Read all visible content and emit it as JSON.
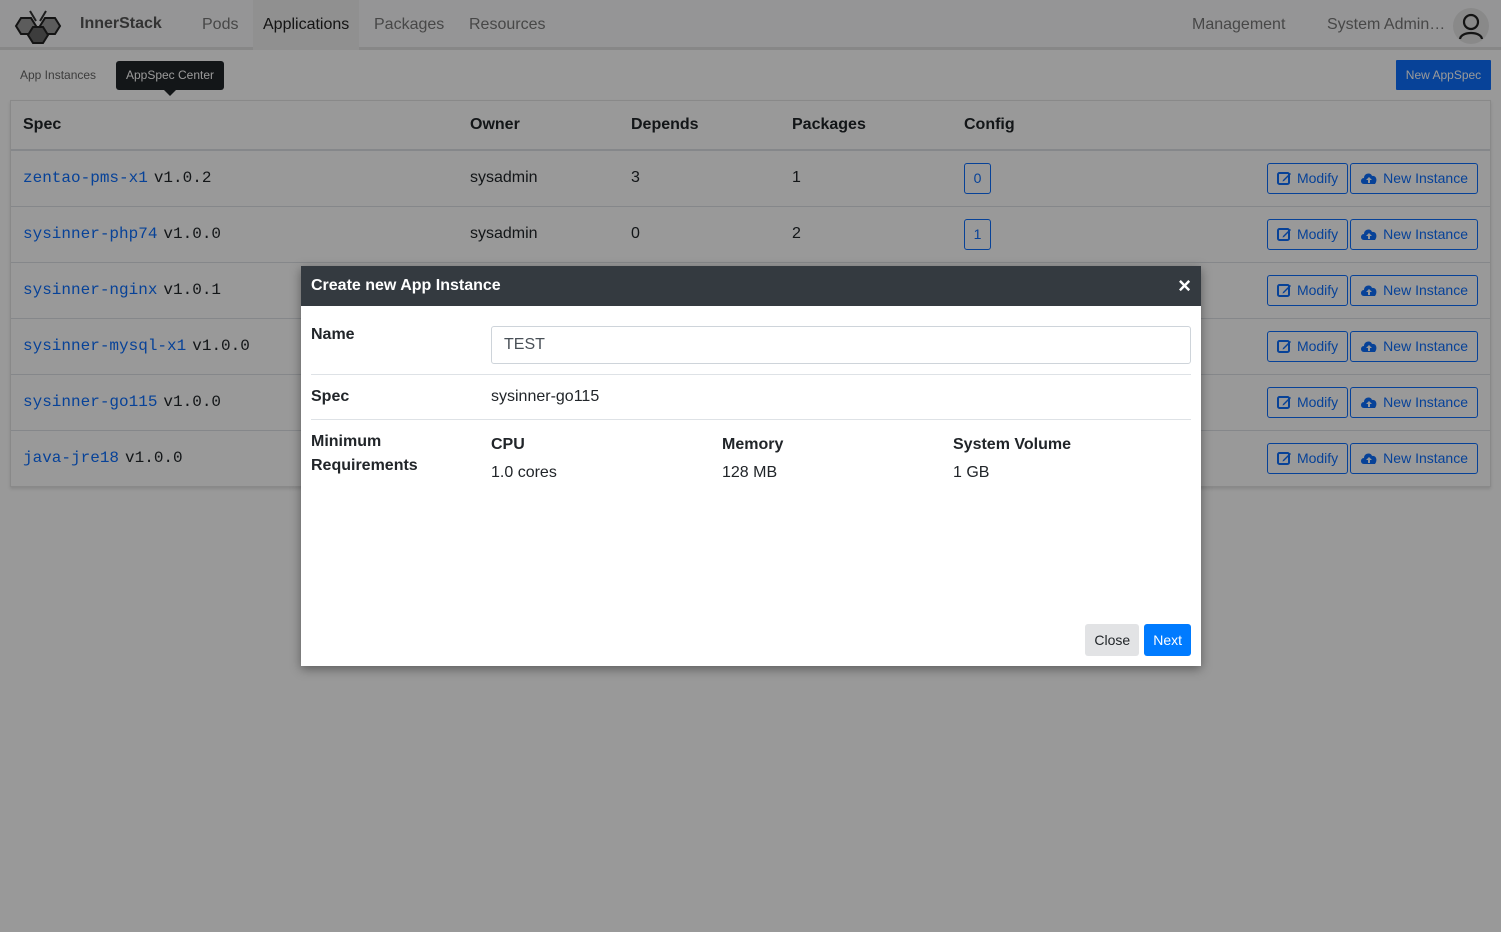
{
  "brand": {
    "name": "InnerStack",
    "logo_icon": "hexagon-bee-logo"
  },
  "nav": {
    "items": [
      {
        "label": "Pods",
        "active": false
      },
      {
        "label": "Applications",
        "active": true
      },
      {
        "label": "Packages",
        "active": false
      },
      {
        "label": "Resources",
        "active": false
      }
    ],
    "right": {
      "management": "Management",
      "user": "System Admin…",
      "avatar_icon": "user-icon"
    }
  },
  "subnav": {
    "app_instances": "App Instances",
    "appspec_center": "AppSpec Center",
    "tooltip": "AppSpec Center",
    "new_appspec": "New AppSpec"
  },
  "table": {
    "headers": [
      "Spec",
      "Owner",
      "Depends",
      "Packages",
      "Config"
    ],
    "rows": [
      {
        "name": "zentao-pms-x1",
        "version": "v1.0.2",
        "owner": "sysadmin",
        "depends": "3",
        "packages": "1",
        "config": "0"
      },
      {
        "name": "sysinner-php74",
        "version": "v1.0.0",
        "owner": "sysadmin",
        "depends": "0",
        "packages": "2",
        "config": "1"
      },
      {
        "name": "sysinner-nginx",
        "version": "v1.0.1",
        "owner": "",
        "depends": "",
        "packages": "",
        "config": ""
      },
      {
        "name": "sysinner-mysql-x1",
        "version": "v1.0.0",
        "owner": "",
        "depends": "",
        "packages": "",
        "config": ""
      },
      {
        "name": "sysinner-go115",
        "version": "v1.0.0",
        "owner": "",
        "depends": "",
        "packages": "",
        "config": ""
      },
      {
        "name": "java-jre18",
        "version": "v1.0.0",
        "owner": "",
        "depends": "",
        "packages": "",
        "config": ""
      }
    ],
    "actions": {
      "modify": "Modify",
      "new_instance": "New Instance"
    }
  },
  "modal": {
    "title": "Create new App Instance",
    "close_glyph": "×",
    "name_label": "Name",
    "name_value": "TEST",
    "spec_label": "Spec",
    "spec_value": "sysinner-go115",
    "req_label": "Minimum Requirements",
    "requirements": [
      {
        "label": "CPU",
        "value": "1.0 cores"
      },
      {
        "label": "Memory",
        "value": "128 MB"
      },
      {
        "label": "System Volume",
        "value": "1 GB"
      }
    ],
    "close_button": "Close",
    "next_button": "Next"
  },
  "colors": {
    "primary": "#0d6efd",
    "modal_header": "#343a40",
    "next_button": "#007bff"
  }
}
